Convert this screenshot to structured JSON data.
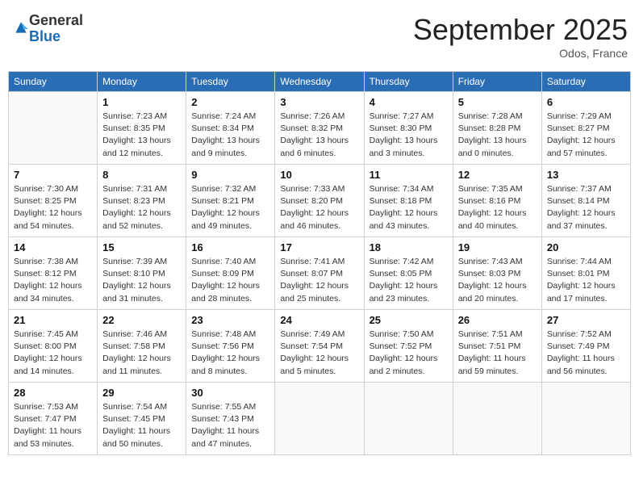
{
  "header": {
    "logo_general": "General",
    "logo_blue": "Blue",
    "month_title": "September 2025",
    "location": "Odos, France"
  },
  "days_of_week": [
    "Sunday",
    "Monday",
    "Tuesday",
    "Wednesday",
    "Thursday",
    "Friday",
    "Saturday"
  ],
  "weeks": [
    [
      {
        "day": "",
        "info": ""
      },
      {
        "day": "1",
        "info": "Sunrise: 7:23 AM\nSunset: 8:35 PM\nDaylight: 13 hours\nand 12 minutes."
      },
      {
        "day": "2",
        "info": "Sunrise: 7:24 AM\nSunset: 8:34 PM\nDaylight: 13 hours\nand 9 minutes."
      },
      {
        "day": "3",
        "info": "Sunrise: 7:26 AM\nSunset: 8:32 PM\nDaylight: 13 hours\nand 6 minutes."
      },
      {
        "day": "4",
        "info": "Sunrise: 7:27 AM\nSunset: 8:30 PM\nDaylight: 13 hours\nand 3 minutes."
      },
      {
        "day": "5",
        "info": "Sunrise: 7:28 AM\nSunset: 8:28 PM\nDaylight: 13 hours\nand 0 minutes."
      },
      {
        "day": "6",
        "info": "Sunrise: 7:29 AM\nSunset: 8:27 PM\nDaylight: 12 hours\nand 57 minutes."
      }
    ],
    [
      {
        "day": "7",
        "info": "Sunrise: 7:30 AM\nSunset: 8:25 PM\nDaylight: 12 hours\nand 54 minutes."
      },
      {
        "day": "8",
        "info": "Sunrise: 7:31 AM\nSunset: 8:23 PM\nDaylight: 12 hours\nand 52 minutes."
      },
      {
        "day": "9",
        "info": "Sunrise: 7:32 AM\nSunset: 8:21 PM\nDaylight: 12 hours\nand 49 minutes."
      },
      {
        "day": "10",
        "info": "Sunrise: 7:33 AM\nSunset: 8:20 PM\nDaylight: 12 hours\nand 46 minutes."
      },
      {
        "day": "11",
        "info": "Sunrise: 7:34 AM\nSunset: 8:18 PM\nDaylight: 12 hours\nand 43 minutes."
      },
      {
        "day": "12",
        "info": "Sunrise: 7:35 AM\nSunset: 8:16 PM\nDaylight: 12 hours\nand 40 minutes."
      },
      {
        "day": "13",
        "info": "Sunrise: 7:37 AM\nSunset: 8:14 PM\nDaylight: 12 hours\nand 37 minutes."
      }
    ],
    [
      {
        "day": "14",
        "info": "Sunrise: 7:38 AM\nSunset: 8:12 PM\nDaylight: 12 hours\nand 34 minutes."
      },
      {
        "day": "15",
        "info": "Sunrise: 7:39 AM\nSunset: 8:10 PM\nDaylight: 12 hours\nand 31 minutes."
      },
      {
        "day": "16",
        "info": "Sunrise: 7:40 AM\nSunset: 8:09 PM\nDaylight: 12 hours\nand 28 minutes."
      },
      {
        "day": "17",
        "info": "Sunrise: 7:41 AM\nSunset: 8:07 PM\nDaylight: 12 hours\nand 25 minutes."
      },
      {
        "day": "18",
        "info": "Sunrise: 7:42 AM\nSunset: 8:05 PM\nDaylight: 12 hours\nand 23 minutes."
      },
      {
        "day": "19",
        "info": "Sunrise: 7:43 AM\nSunset: 8:03 PM\nDaylight: 12 hours\nand 20 minutes."
      },
      {
        "day": "20",
        "info": "Sunrise: 7:44 AM\nSunset: 8:01 PM\nDaylight: 12 hours\nand 17 minutes."
      }
    ],
    [
      {
        "day": "21",
        "info": "Sunrise: 7:45 AM\nSunset: 8:00 PM\nDaylight: 12 hours\nand 14 minutes."
      },
      {
        "day": "22",
        "info": "Sunrise: 7:46 AM\nSunset: 7:58 PM\nDaylight: 12 hours\nand 11 minutes."
      },
      {
        "day": "23",
        "info": "Sunrise: 7:48 AM\nSunset: 7:56 PM\nDaylight: 12 hours\nand 8 minutes."
      },
      {
        "day": "24",
        "info": "Sunrise: 7:49 AM\nSunset: 7:54 PM\nDaylight: 12 hours\nand 5 minutes."
      },
      {
        "day": "25",
        "info": "Sunrise: 7:50 AM\nSunset: 7:52 PM\nDaylight: 12 hours\nand 2 minutes."
      },
      {
        "day": "26",
        "info": "Sunrise: 7:51 AM\nSunset: 7:51 PM\nDaylight: 11 hours\nand 59 minutes."
      },
      {
        "day": "27",
        "info": "Sunrise: 7:52 AM\nSunset: 7:49 PM\nDaylight: 11 hours\nand 56 minutes."
      }
    ],
    [
      {
        "day": "28",
        "info": "Sunrise: 7:53 AM\nSunset: 7:47 PM\nDaylight: 11 hours\nand 53 minutes."
      },
      {
        "day": "29",
        "info": "Sunrise: 7:54 AM\nSunset: 7:45 PM\nDaylight: 11 hours\nand 50 minutes."
      },
      {
        "day": "30",
        "info": "Sunrise: 7:55 AM\nSunset: 7:43 PM\nDaylight: 11 hours\nand 47 minutes."
      },
      {
        "day": "",
        "info": ""
      },
      {
        "day": "",
        "info": ""
      },
      {
        "day": "",
        "info": ""
      },
      {
        "day": "",
        "info": ""
      }
    ]
  ]
}
